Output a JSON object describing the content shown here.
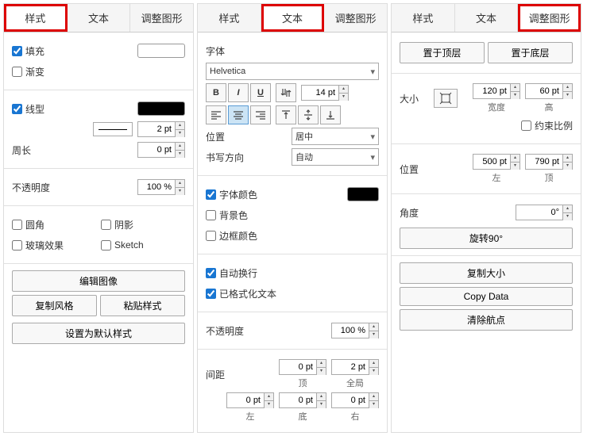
{
  "panel1": {
    "tabs": {
      "style": "样式",
      "text": "文本",
      "adjust": "调整图形"
    },
    "fill": "填充",
    "gradient": "渐变",
    "lineType": "线型",
    "lineWidth": "2 pt",
    "perimeter": "周长",
    "perimeterVal": "0 pt",
    "opacity": "不透明度",
    "opacityVal": "100 %",
    "rounded": "圆角",
    "shadow": "阴影",
    "glass": "玻璃效果",
    "sketch": "Sketch",
    "editImage": "编辑图像",
    "copyStyle": "复制风格",
    "pasteStyle": "粘贴样式",
    "setDefault": "设置为默认样式"
  },
  "panel2": {
    "tabs": {
      "style": "样式",
      "text": "文本",
      "adjust": "调整图形"
    },
    "font": "字体",
    "fontFamily": "Helvetica",
    "fontSize": "14 pt",
    "position": "位置",
    "positionVal": "居中",
    "writeDir": "书写方向",
    "writeDirVal": "自动",
    "fontColor": "字体颜色",
    "bgColor": "背景色",
    "borderColor": "边框颜色",
    "autoWrap": "自动换行",
    "formatted": "已格式化文本",
    "opacity": "不透明度",
    "opacityVal": "100 %",
    "spacing": "间距",
    "spacing_top": "0 pt",
    "spacing_global": "2 pt",
    "spacing_left": "0 pt",
    "spacing_bottom": "0 pt",
    "spacing_right": "0 pt",
    "lbl_top": "顶",
    "lbl_global": "全局",
    "lbl_left": "左",
    "lbl_bottom": "底",
    "lbl_right": "右"
  },
  "panel3": {
    "tabs": {
      "style": "样式",
      "text": "文本",
      "adjust": "调整图形"
    },
    "toTop": "置于顶层",
    "toBottom": "置于底层",
    "size": "大小",
    "width": "120 pt",
    "height": "60 pt",
    "lbl_width": "宽度",
    "lbl_height": "高",
    "constrain": "约束比例",
    "position": "位置",
    "posLeft": "500 pt",
    "posTop": "790 pt",
    "lbl_left": "左",
    "lbl_top": "顶",
    "angle": "角度",
    "angleVal": "0°",
    "rotate90": "旋转90°",
    "copySize": "复制大小",
    "copyData": "Copy Data",
    "clearWaypoint": "清除航点"
  }
}
